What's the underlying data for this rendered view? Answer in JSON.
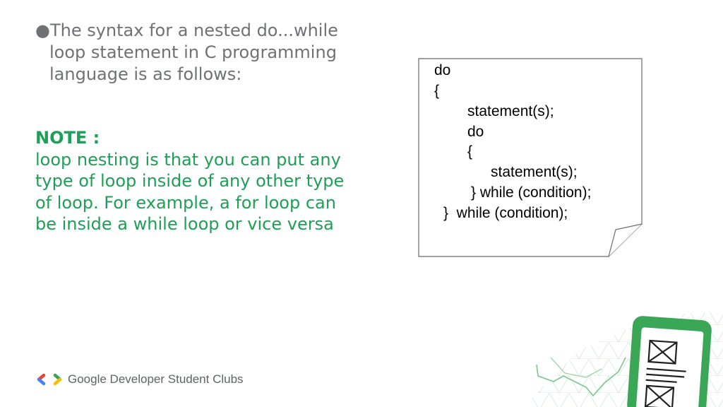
{
  "slide": {
    "bullet": {
      "dot": "●",
      "lines": [
        "The syntax for a nested do...while",
        "loop statement in C programming",
        "language is as follows:"
      ]
    },
    "note": {
      "title": "NOTE :",
      "lines": [
        "loop nesting is that you can put any",
        "type of loop inside of any other type",
        "of loop. For example, a for loop can",
        "be inside a while loop or vice versa"
      ]
    },
    "code": {
      "lines": [
        "do",
        "{",
        "statement(s);",
        "do",
        "{",
        "statement(s);",
        "} while (condition);",
        "}  while (condition);"
      ]
    },
    "footer": {
      "brand": "Google Developer Student Clubs",
      "logo_icon": "gdsc-brackets-logo",
      "logo_colors": [
        "#ea4335",
        "#4285f4",
        "#34a853",
        "#fbbc04"
      ]
    },
    "colors": {
      "bullet_text": "#6f7175",
      "note_text": "#1f9e57",
      "illustration_green": "#34a853"
    },
    "illustration_icon": "phone-with-mail-icons-illustration"
  }
}
